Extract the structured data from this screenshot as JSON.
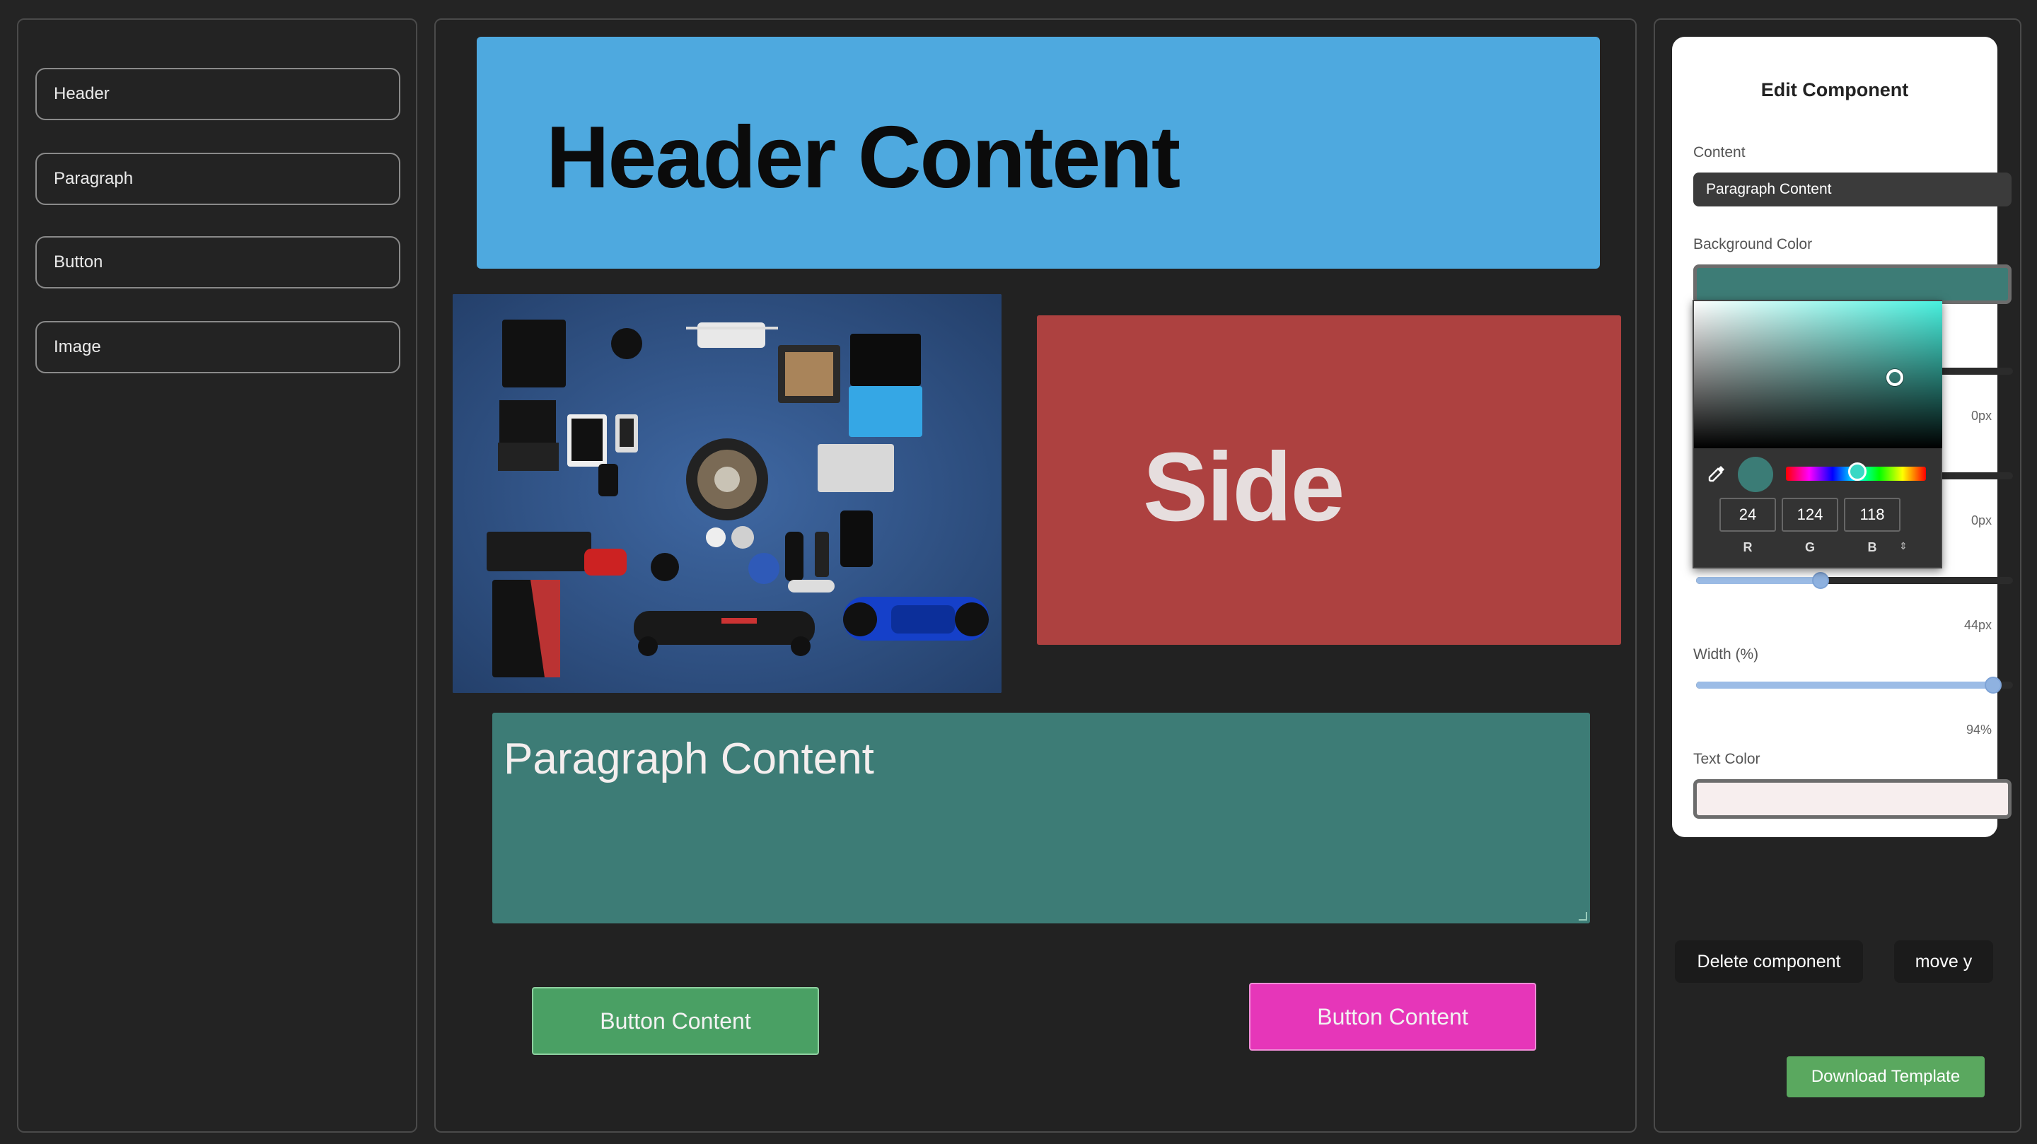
{
  "components_panel": {
    "items": [
      {
        "label": "Header"
      },
      {
        "label": "Paragraph"
      },
      {
        "label": "Button"
      },
      {
        "label": "Image"
      }
    ]
  },
  "canvas": {
    "header": {
      "text": "Header Content",
      "bg": "#4ea9df"
    },
    "image": {
      "alt": "flat-lay of gadgets"
    },
    "side": {
      "text": "Side",
      "bg": "#ad4140"
    },
    "paragraph": {
      "text": "Paragraph Content",
      "bg": "#3d7c76"
    },
    "button_left": {
      "text": "Button Content",
      "bg": "#4aa064"
    },
    "button_right": {
      "text": "Button Content",
      "bg": "#e636b9"
    }
  },
  "editor": {
    "title": "Edit Component",
    "content_label": "Content",
    "content_value": "Paragraph Content",
    "bg_color_label": "Background Color",
    "bg_color_value": "#3d7c76",
    "slider1_value": "0px",
    "slider2_value": "0px",
    "slider3_value": "44px",
    "width_label": "Width (%)",
    "width_value": "94%",
    "text_color_label": "Text Color",
    "text_color_value": "#f7eeee",
    "color_picker": {
      "r": "24",
      "g": "124",
      "b": "118",
      "r_label": "R",
      "g_label": "G",
      "b_label": "B",
      "toggle_glyph": "⇕"
    },
    "delete_button": "Delete component",
    "move_button": "move y"
  },
  "download_button": "Download Template"
}
